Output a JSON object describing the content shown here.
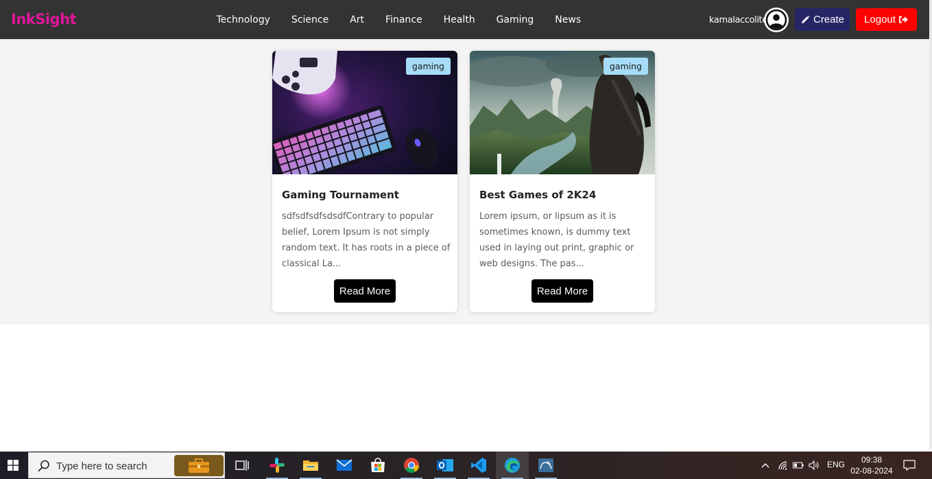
{
  "header": {
    "logo": "InkSight",
    "nav": [
      "Technology",
      "Science",
      "Art",
      "Finance",
      "Health",
      "Gaming",
      "News"
    ],
    "username": "kamalaccolite",
    "create_label": "Create",
    "logout_label": "Logout"
  },
  "posts": [
    {
      "tag": "gaming",
      "title": "Gaming Tournament",
      "excerpt": "sdfsdfsdfsdsdfContrary to popular belief, Lorem Ipsum is not simply random text. It has roots in a piece of classical La...",
      "button": "Read More"
    },
    {
      "tag": "gaming",
      "title": "Best Games of 2K24",
      "excerpt": "Lorem ipsum, or lipsum as it is sometimes known, is dummy text used in laying out print, graphic or web designs. The pas...",
      "button": "Read More"
    }
  ],
  "taskbar": {
    "search_placeholder": "Type here to search",
    "apps": [
      "task-view-icon",
      "slack-icon",
      "file-explorer-icon",
      "mail-icon",
      "microsoft-store-icon",
      "chrome-icon",
      "outlook-icon",
      "vscode-icon",
      "edge-icon",
      "mysql-workbench-icon"
    ],
    "language": "ENG",
    "time": "09:38",
    "date": "02-08-2024"
  },
  "colors": {
    "navbar": "#333333",
    "logo": "#e0169b",
    "create_button": "#252566",
    "logout_button": "#ff0000",
    "tag": "#a6dcf7"
  }
}
